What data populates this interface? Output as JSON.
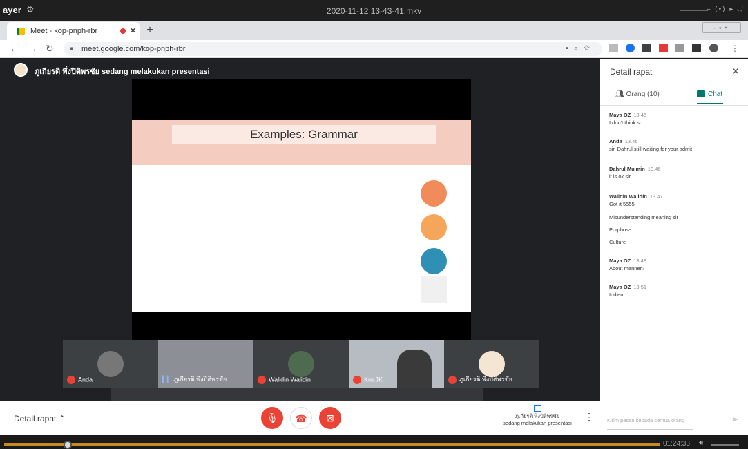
{
  "player": {
    "app_name": "ayer",
    "file_name": "2020-11-12 13-43-41.mkv",
    "time": "01:24:33",
    "window_controls": "– (•) ▸ ⛶"
  },
  "browser": {
    "tab_title": "Meet - kop-pnph-rbr",
    "url": "meet.google.com/kop-pnph-rbr"
  },
  "meet": {
    "presenter_banner": "ภูเกียรติ พึ่งปิติพรชัย sedang melakukan presentasi",
    "slide_title": "Examples: Grammar",
    "tiles": [
      {
        "name": "Anda"
      },
      {
        "name": "ภูเกียรติ พึ่งปิติพรชัย"
      },
      {
        "name": "Walidin Walidin"
      },
      {
        "name": "Kru.JK"
      },
      {
        "name": "ภูเกียรติ พึ่งปิติพรชัย"
      }
    ],
    "bottom": {
      "details_label": "Detail rapat",
      "present_line1": "ภูเกียรติ พึ่งปิติพรชัย",
      "present_line2": "sedang melakukan presentasi"
    }
  },
  "sidebar": {
    "header": "Detail rapat",
    "tab_people": "Orang (10)",
    "tab_chat": "Chat",
    "messages": [
      {
        "sender": "Maya OZ",
        "time": "13.46",
        "lines": [
          "I don't think so"
        ]
      },
      {
        "sender": "Anda",
        "time": "13.46",
        "lines": [
          "sir. Dahrul still waiting for your admit"
        ]
      },
      {
        "sender": "Dahrul Mu'min",
        "time": "13.46",
        "lines": [
          "it is ok sir"
        ]
      },
      {
        "sender": "Walidin Walidin",
        "time": "13.47",
        "lines": [
          "Got it 5555",
          "Misunderstanding meaning sir",
          "Purphose",
          "Culture"
        ]
      },
      {
        "sender": "Maya OZ",
        "time": "13.48",
        "lines": [
          "About manner?"
        ]
      },
      {
        "sender": "Maya OZ",
        "time": "13.51",
        "lines": [
          "Indien"
        ]
      }
    ],
    "input_placeholder": "Kirim pesan kepada semua orang"
  }
}
